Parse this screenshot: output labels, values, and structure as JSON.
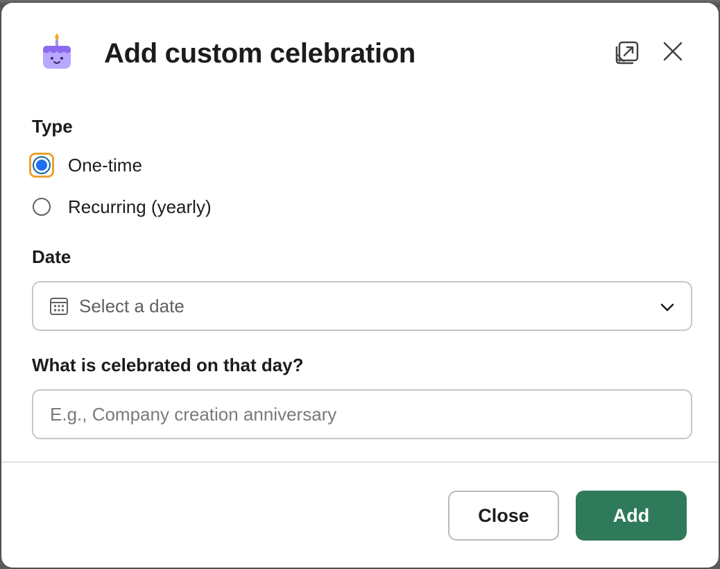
{
  "dialog": {
    "title": "Add custom celebration",
    "header_icon": "birthday-cake-icon",
    "popout_icon": "popout-window-icon",
    "close_icon": "close-icon"
  },
  "type_section": {
    "label": "Type",
    "options": [
      {
        "label": "One-time",
        "selected": true
      },
      {
        "label": "Recurring (yearly)",
        "selected": false
      }
    ]
  },
  "date_section": {
    "label": "Date",
    "placeholder": "Select a date",
    "icon": "calendar-icon",
    "dropdown_icon": "chevron-down-icon"
  },
  "celebration_section": {
    "label": "What is celebrated on that day?",
    "placeholder": "E.g., Company creation anniversary",
    "value": ""
  },
  "footer": {
    "close_label": "Close",
    "add_label": "Add"
  },
  "colors": {
    "primary_button": "#2f7a5a",
    "radio_selected": "#1d6ff0",
    "focus_ring": "#e8a330"
  }
}
